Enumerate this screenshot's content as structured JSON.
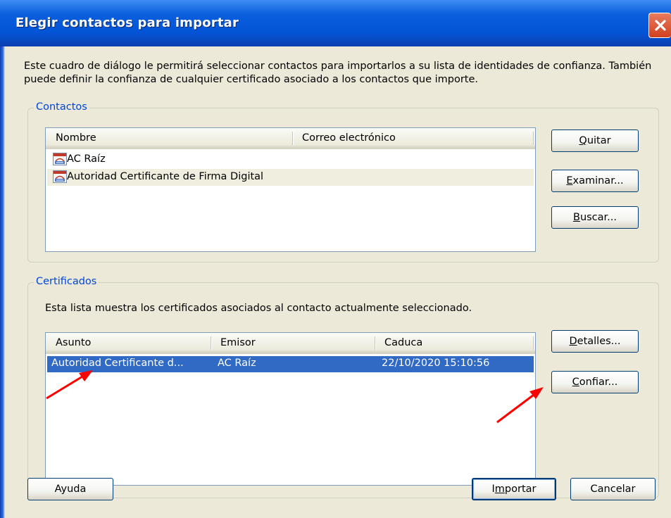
{
  "window": {
    "title": "Elegir contactos para importar"
  },
  "description": "Este cuadro de diálogo le permitirá seleccionar contactos para importarlos a su lista de identidades de confianza. También puede definir la confianza de cualquier certificado asociado a los contactos que importe.",
  "contacts": {
    "group_label": "Contactos",
    "columns": [
      "Nombre",
      "Correo electrónico"
    ],
    "rows": [
      {
        "name": "AC Raíz",
        "email": ""
      },
      {
        "name": "Autoridad Certificante de Firma Digital",
        "email": ""
      }
    ],
    "buttons": {
      "remove": {
        "mnemonic": "Q",
        "rest": "uitar"
      },
      "browse": {
        "mnemonic": "E",
        "rest": "xaminar..."
      },
      "search": {
        "mnemonic": "B",
        "rest": "uscar..."
      }
    }
  },
  "certificates": {
    "group_label": "Certificados",
    "description": "Esta lista muestra los certificados asociados al contacto actualmente seleccionado.",
    "columns": [
      "Asunto",
      "Emisor",
      "Caduca"
    ],
    "rows": [
      {
        "subject": "Autoridad Certificante d...",
        "issuer": "AC Raíz",
        "expires": "22/10/2020 15:10:56"
      }
    ],
    "buttons": {
      "details": {
        "mnemonic": "D",
        "rest": "etalles..."
      },
      "trust": {
        "mnemonic": "C",
        "rest": "onfiar..."
      }
    }
  },
  "footer": {
    "help": "Ayuda",
    "import": {
      "before": "I",
      "mnemonic": "m",
      "rest": "portar"
    },
    "cancel": "Cancelar"
  },
  "colors": {
    "title_bar": "#0454d6",
    "selection": "#316ac5",
    "annotation_arrow": "#ff0000",
    "group_label": "#0046d5"
  },
  "icons": [
    "close-icon",
    "contact-card-icon",
    "red-arrow-annotation"
  ]
}
